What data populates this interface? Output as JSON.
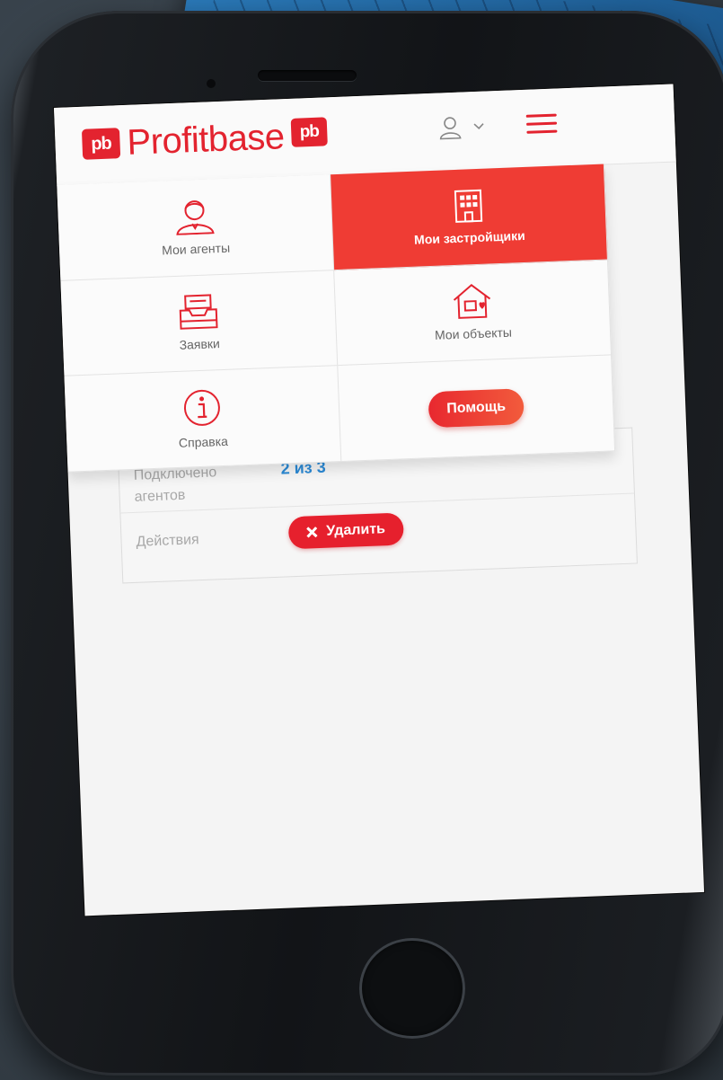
{
  "brand": {
    "mark": "pb",
    "name": "Profitbase",
    "color": "#e3232f"
  },
  "header": {
    "user_icon": "user-icon",
    "dropdown_icon": "chevron-down-icon",
    "menu_icon": "hamburger-icon"
  },
  "menu": {
    "items": [
      {
        "label": "Мои агенты",
        "icon": "agent-icon",
        "active": false
      },
      {
        "label": "Мои застройщики",
        "icon": "building-icon",
        "active": true
      },
      {
        "label": "Заявки",
        "icon": "inbox-icon",
        "active": false
      },
      {
        "label": "Мои объекты",
        "icon": "house-heart-icon",
        "active": false
      },
      {
        "label": "Справка",
        "icon": "info-icon",
        "active": false
      }
    ],
    "help_button": "Помощь",
    "active_color": "#ef3c34"
  },
  "details": {
    "connected_label": "Подключено агентов",
    "connected_value": "2 из 3",
    "actions_label": "Действия",
    "delete_label": "Удалить",
    "value_color": "#2b8ad6"
  }
}
